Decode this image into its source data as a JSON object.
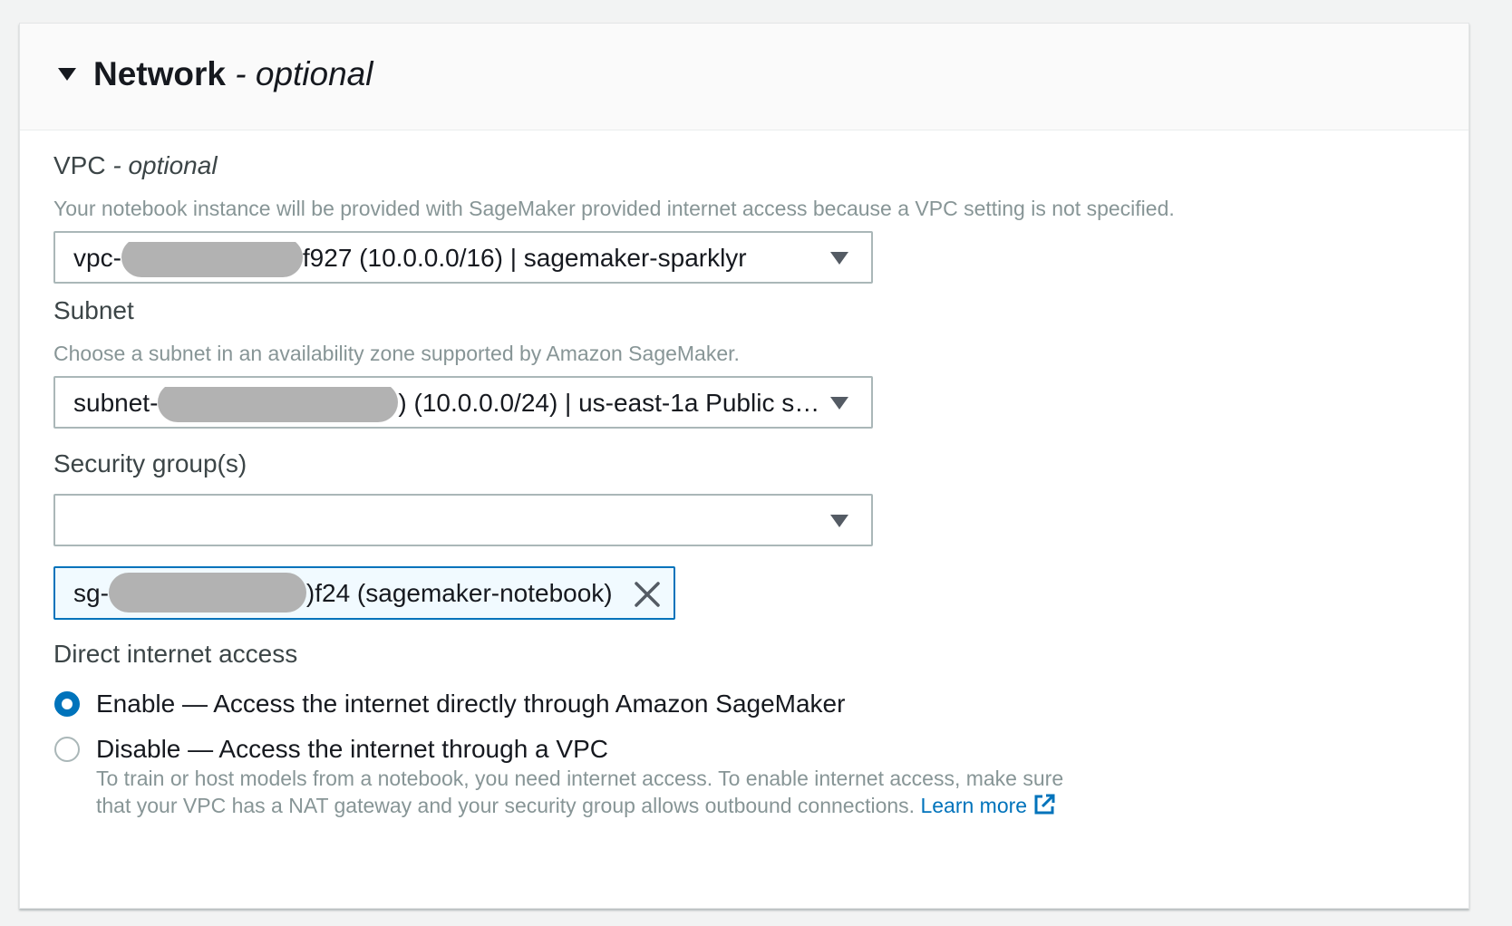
{
  "section": {
    "title": "Network",
    "title_suffix": "- optional",
    "expand_icon": "caret-down-icon"
  },
  "vpc": {
    "label": "VPC",
    "label_suffix": "- optional",
    "description": "Your notebook instance will be provided with SageMaker provided internet access because a VPC setting is not specified.",
    "value_prefix": "vpc-",
    "value_suffix": "f927 (10.0.0.0/16) | sagemaker-sparklyr"
  },
  "subnet": {
    "label": "Subnet",
    "description": "Choose a subnet in an availability zone supported by Amazon SageMaker.",
    "value_prefix": "subnet-",
    "value_suffix": ") (10.0.0.0/24) | us-east-1a Public s…"
  },
  "security_groups": {
    "label": "Security group(s)",
    "value": "",
    "tokens": [
      {
        "prefix": "sg-",
        "suffix": ")f24 (sagemaker-notebook)",
        "remove_icon": "close-icon"
      }
    ]
  },
  "direct_internet_access": {
    "label": "Direct internet access",
    "selected": "enable",
    "options": [
      {
        "id": "enable",
        "label": "Enable — Access the internet directly through Amazon SageMaker"
      },
      {
        "id": "disable",
        "label": "Disable — Access the internet through a VPC"
      }
    ],
    "help_text": "To train or host models from a notebook, you need internet access. To enable internet access, make sure that your VPC has a NAT gateway and your security group allows outbound connections.",
    "learn_more": "Learn more",
    "learn_more_icon": "external-link-icon"
  },
  "colors": {
    "accent": "#0073bb",
    "text": "#16191f",
    "muted": "#879596",
    "border": "#aab7b8",
    "redaction": "#b2b2b2"
  }
}
